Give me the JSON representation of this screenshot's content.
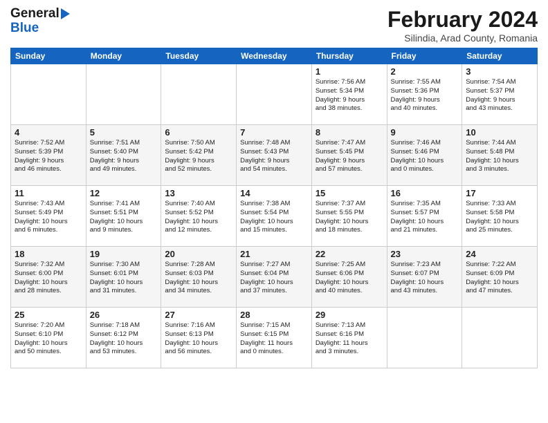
{
  "logo": {
    "line1": "General",
    "line2": "Blue"
  },
  "title": "February 2024",
  "subtitle": "Silindia, Arad County, Romania",
  "days": [
    "Sunday",
    "Monday",
    "Tuesday",
    "Wednesday",
    "Thursday",
    "Friday",
    "Saturday"
  ],
  "weeks": [
    [
      {
        "date": "",
        "info": ""
      },
      {
        "date": "",
        "info": ""
      },
      {
        "date": "",
        "info": ""
      },
      {
        "date": "",
        "info": ""
      },
      {
        "date": "1",
        "info": "Sunrise: 7:56 AM\nSunset: 5:34 PM\nDaylight: 9 hours\nand 38 minutes."
      },
      {
        "date": "2",
        "info": "Sunrise: 7:55 AM\nSunset: 5:36 PM\nDaylight: 9 hours\nand 40 minutes."
      },
      {
        "date": "3",
        "info": "Sunrise: 7:54 AM\nSunset: 5:37 PM\nDaylight: 9 hours\nand 43 minutes."
      }
    ],
    [
      {
        "date": "4",
        "info": "Sunrise: 7:52 AM\nSunset: 5:39 PM\nDaylight: 9 hours\nand 46 minutes."
      },
      {
        "date": "5",
        "info": "Sunrise: 7:51 AM\nSunset: 5:40 PM\nDaylight: 9 hours\nand 49 minutes."
      },
      {
        "date": "6",
        "info": "Sunrise: 7:50 AM\nSunset: 5:42 PM\nDaylight: 9 hours\nand 52 minutes."
      },
      {
        "date": "7",
        "info": "Sunrise: 7:48 AM\nSunset: 5:43 PM\nDaylight: 9 hours\nand 54 minutes."
      },
      {
        "date": "8",
        "info": "Sunrise: 7:47 AM\nSunset: 5:45 PM\nDaylight: 9 hours\nand 57 minutes."
      },
      {
        "date": "9",
        "info": "Sunrise: 7:46 AM\nSunset: 5:46 PM\nDaylight: 10 hours\nand 0 minutes."
      },
      {
        "date": "10",
        "info": "Sunrise: 7:44 AM\nSunset: 5:48 PM\nDaylight: 10 hours\nand 3 minutes."
      }
    ],
    [
      {
        "date": "11",
        "info": "Sunrise: 7:43 AM\nSunset: 5:49 PM\nDaylight: 10 hours\nand 6 minutes."
      },
      {
        "date": "12",
        "info": "Sunrise: 7:41 AM\nSunset: 5:51 PM\nDaylight: 10 hours\nand 9 minutes."
      },
      {
        "date": "13",
        "info": "Sunrise: 7:40 AM\nSunset: 5:52 PM\nDaylight: 10 hours\nand 12 minutes."
      },
      {
        "date": "14",
        "info": "Sunrise: 7:38 AM\nSunset: 5:54 PM\nDaylight: 10 hours\nand 15 minutes."
      },
      {
        "date": "15",
        "info": "Sunrise: 7:37 AM\nSunset: 5:55 PM\nDaylight: 10 hours\nand 18 minutes."
      },
      {
        "date": "16",
        "info": "Sunrise: 7:35 AM\nSunset: 5:57 PM\nDaylight: 10 hours\nand 21 minutes."
      },
      {
        "date": "17",
        "info": "Sunrise: 7:33 AM\nSunset: 5:58 PM\nDaylight: 10 hours\nand 25 minutes."
      }
    ],
    [
      {
        "date": "18",
        "info": "Sunrise: 7:32 AM\nSunset: 6:00 PM\nDaylight: 10 hours\nand 28 minutes."
      },
      {
        "date": "19",
        "info": "Sunrise: 7:30 AM\nSunset: 6:01 PM\nDaylight: 10 hours\nand 31 minutes."
      },
      {
        "date": "20",
        "info": "Sunrise: 7:28 AM\nSunset: 6:03 PM\nDaylight: 10 hours\nand 34 minutes."
      },
      {
        "date": "21",
        "info": "Sunrise: 7:27 AM\nSunset: 6:04 PM\nDaylight: 10 hours\nand 37 minutes."
      },
      {
        "date": "22",
        "info": "Sunrise: 7:25 AM\nSunset: 6:06 PM\nDaylight: 10 hours\nand 40 minutes."
      },
      {
        "date": "23",
        "info": "Sunrise: 7:23 AM\nSunset: 6:07 PM\nDaylight: 10 hours\nand 43 minutes."
      },
      {
        "date": "24",
        "info": "Sunrise: 7:22 AM\nSunset: 6:09 PM\nDaylight: 10 hours\nand 47 minutes."
      }
    ],
    [
      {
        "date": "25",
        "info": "Sunrise: 7:20 AM\nSunset: 6:10 PM\nDaylight: 10 hours\nand 50 minutes."
      },
      {
        "date": "26",
        "info": "Sunrise: 7:18 AM\nSunset: 6:12 PM\nDaylight: 10 hours\nand 53 minutes."
      },
      {
        "date": "27",
        "info": "Sunrise: 7:16 AM\nSunset: 6:13 PM\nDaylight: 10 hours\nand 56 minutes."
      },
      {
        "date": "28",
        "info": "Sunrise: 7:15 AM\nSunset: 6:15 PM\nDaylight: 11 hours\nand 0 minutes."
      },
      {
        "date": "29",
        "info": "Sunrise: 7:13 AM\nSunset: 6:16 PM\nDaylight: 11 hours\nand 3 minutes."
      },
      {
        "date": "",
        "info": ""
      },
      {
        "date": "",
        "info": ""
      }
    ]
  ]
}
